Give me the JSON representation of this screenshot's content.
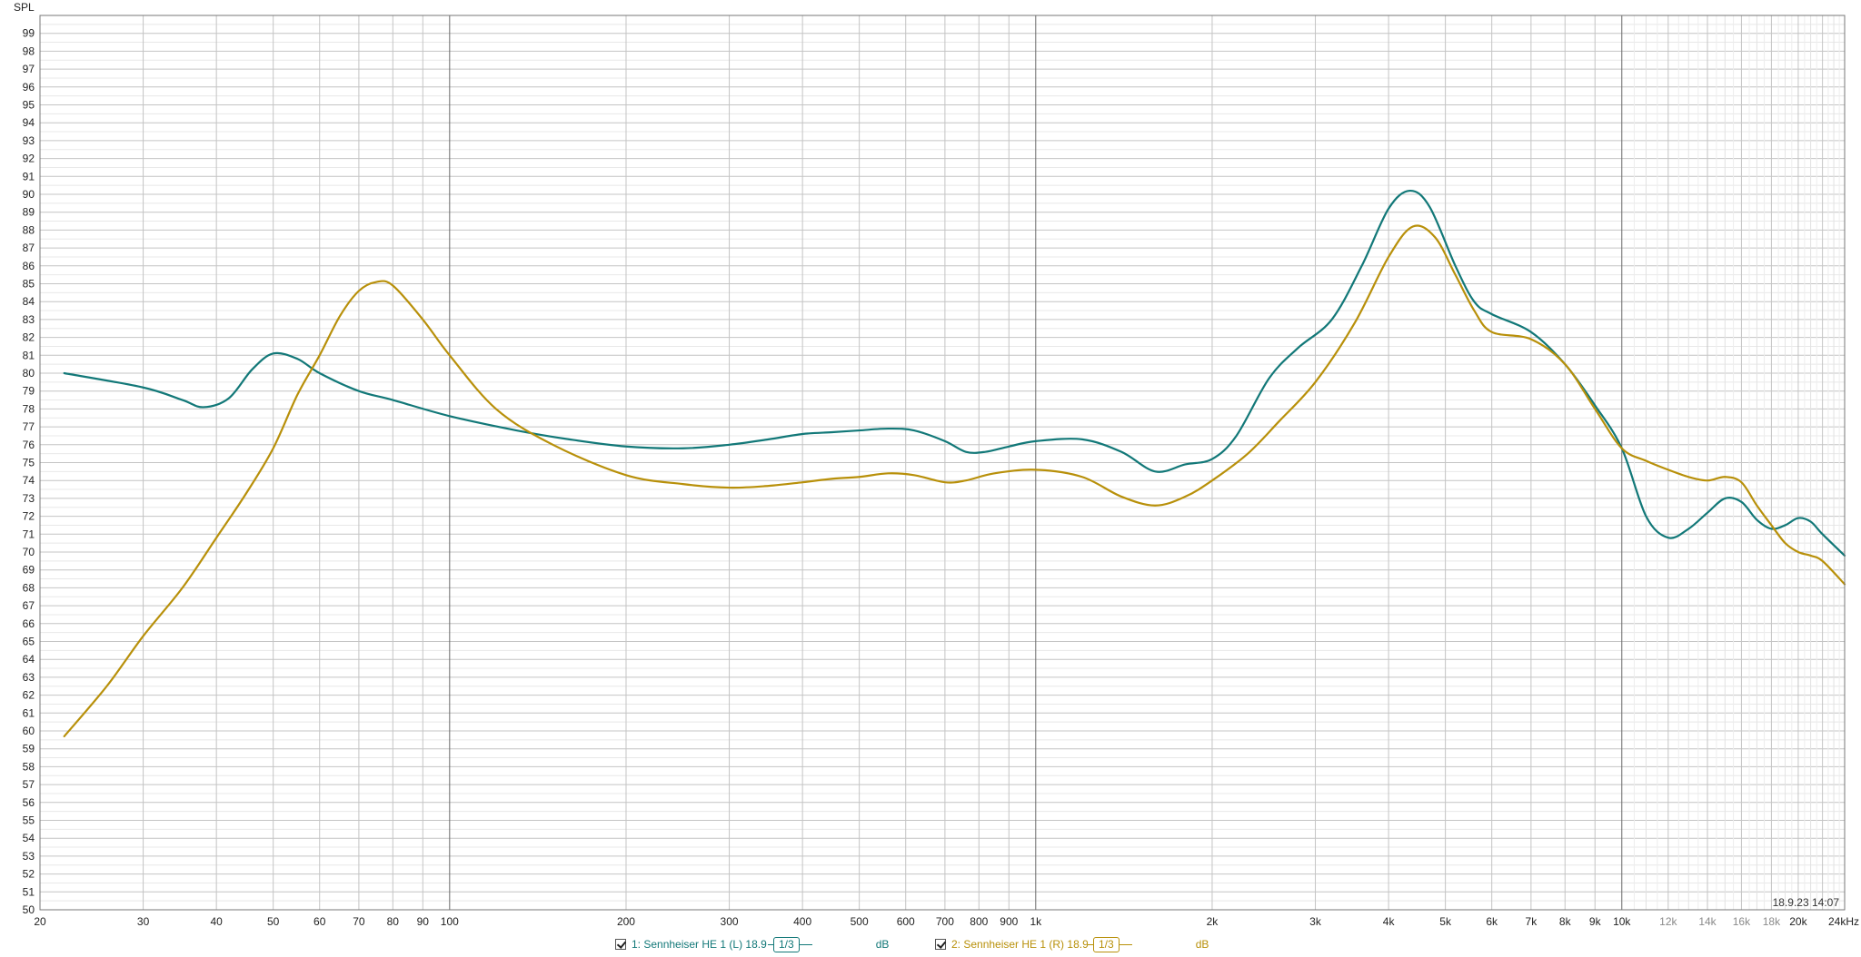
{
  "chart_data": {
    "type": "line",
    "ylabel": "SPL",
    "x_scale": "log",
    "xlim": [
      20,
      24000
    ],
    "ylim": [
      50,
      100
    ],
    "grid": true,
    "x_ticks": [
      {
        "v": 20,
        "label": "20"
      },
      {
        "v": 30,
        "label": "30"
      },
      {
        "v": 40,
        "label": "40"
      },
      {
        "v": 50,
        "label": "50"
      },
      {
        "v": 60,
        "label": "60"
      },
      {
        "v": 70,
        "label": "70"
      },
      {
        "v": 80,
        "label": "80"
      },
      {
        "v": 90,
        "label": "90"
      },
      {
        "v": 100,
        "label": "100"
      },
      {
        "v": 200,
        "label": "200"
      },
      {
        "v": 300,
        "label": "300"
      },
      {
        "v": 400,
        "label": "400"
      },
      {
        "v": 500,
        "label": "500"
      },
      {
        "v": 600,
        "label": "600"
      },
      {
        "v": 700,
        "label": "700"
      },
      {
        "v": 800,
        "label": "800"
      },
      {
        "v": 900,
        "label": "900"
      },
      {
        "v": 1000,
        "label": "1k"
      },
      {
        "v": 2000,
        "label": "2k"
      },
      {
        "v": 3000,
        "label": "3k"
      },
      {
        "v": 4000,
        "label": "4k"
      },
      {
        "v": 5000,
        "label": "5k"
      },
      {
        "v": 6000,
        "label": "6k"
      },
      {
        "v": 7000,
        "label": "7k"
      },
      {
        "v": 8000,
        "label": "8k"
      },
      {
        "v": 9000,
        "label": "9k"
      },
      {
        "v": 10000,
        "label": "10k"
      },
      {
        "v": 12000,
        "label": "12k",
        "light": true
      },
      {
        "v": 14000,
        "label": "14k",
        "light": true
      },
      {
        "v": 16000,
        "label": "16k",
        "light": true
      },
      {
        "v": 18000,
        "label": "18k",
        "light": true
      },
      {
        "v": 20000,
        "label": "20k"
      },
      {
        "v": 24000,
        "label": "24kHz"
      }
    ],
    "series": [
      {
        "name": "1: Sennheiser HE 1 (L) 18.9",
        "color": "#127878",
        "x": [
          22,
          30,
          35,
          38,
          42,
          46,
          50,
          55,
          60,
          70,
          80,
          100,
          130,
          160,
          200,
          250,
          300,
          350,
          400,
          450,
          500,
          560,
          620,
          700,
          760,
          820,
          900,
          1000,
          1200,
          1400,
          1600,
          1800,
          2000,
          2200,
          2500,
          2800,
          3200,
          3600,
          4000,
          4350,
          4700,
          5200,
          5600,
          6000,
          7000,
          8000,
          9000,
          10000,
          11000,
          12000,
          13000,
          14000,
          15000,
          16000,
          17000,
          18000,
          19000,
          20000,
          21000,
          22000,
          24000
        ],
        "y": [
          80.0,
          79.2,
          78.5,
          78.1,
          78.6,
          80.2,
          81.1,
          80.8,
          80.0,
          79.0,
          78.5,
          77.6,
          76.8,
          76.3,
          75.9,
          75.8,
          76.0,
          76.3,
          76.6,
          76.7,
          76.8,
          76.9,
          76.8,
          76.2,
          75.6,
          75.6,
          75.9,
          76.2,
          76.3,
          75.6,
          74.5,
          74.9,
          75.2,
          76.5,
          79.7,
          81.4,
          83.0,
          86.0,
          89.2,
          90.2,
          89.3,
          86.0,
          84.0,
          83.3,
          82.3,
          80.5,
          78.2,
          75.8,
          72.0,
          70.8,
          71.3,
          72.2,
          73.0,
          72.8,
          71.8,
          71.3,
          71.5,
          71.9,
          71.7,
          71.0,
          69.8
        ]
      },
      {
        "name": "2: Sennheiser HE 1 (R) 18.9",
        "color": "#b8900a",
        "x": [
          22,
          26,
          30,
          35,
          40,
          45,
          50,
          55,
          60,
          65,
          70,
          75,
          80,
          90,
          100,
          120,
          150,
          200,
          250,
          300,
          350,
          400,
          450,
          500,
          560,
          620,
          700,
          760,
          850,
          1000,
          1200,
          1400,
          1600,
          1800,
          2000,
          2300,
          2600,
          3000,
          3500,
          4000,
          4400,
          4800,
          5200,
          5600,
          6000,
          7000,
          8000,
          9000,
          10000,
          11000,
          12000,
          13000,
          14000,
          15000,
          16000,
          17000,
          18000,
          19000,
          20000,
          21000,
          22000,
          24000
        ],
        "y": [
          59.7,
          62.5,
          65.3,
          68.0,
          70.8,
          73.3,
          75.8,
          78.8,
          81.0,
          83.2,
          84.6,
          85.1,
          84.9,
          83.0,
          81.0,
          78.0,
          76.0,
          74.3,
          73.8,
          73.6,
          73.7,
          73.9,
          74.1,
          74.2,
          74.4,
          74.3,
          73.9,
          74.0,
          74.4,
          74.6,
          74.2,
          73.1,
          72.6,
          73.1,
          74.0,
          75.5,
          77.3,
          79.5,
          82.8,
          86.5,
          88.2,
          87.6,
          85.5,
          83.5,
          82.3,
          81.9,
          80.5,
          78.0,
          75.8,
          75.1,
          74.6,
          74.2,
          74.0,
          74.2,
          73.9,
          72.6,
          71.5,
          70.5,
          70.0,
          69.8,
          69.5,
          68.2
        ]
      }
    ]
  },
  "timestamp": "18.9.23 14:07",
  "legend": {
    "items": [
      {
        "label": "1: Sennheiser HE 1 (L) 18.9",
        "smoothing": "1/3",
        "unit": "dB",
        "color": "#127878"
      },
      {
        "label": "2: Sennheiser HE 1 (R) 18.9",
        "smoothing": "1/3",
        "unit": "dB",
        "color": "#b8900a"
      }
    ]
  }
}
